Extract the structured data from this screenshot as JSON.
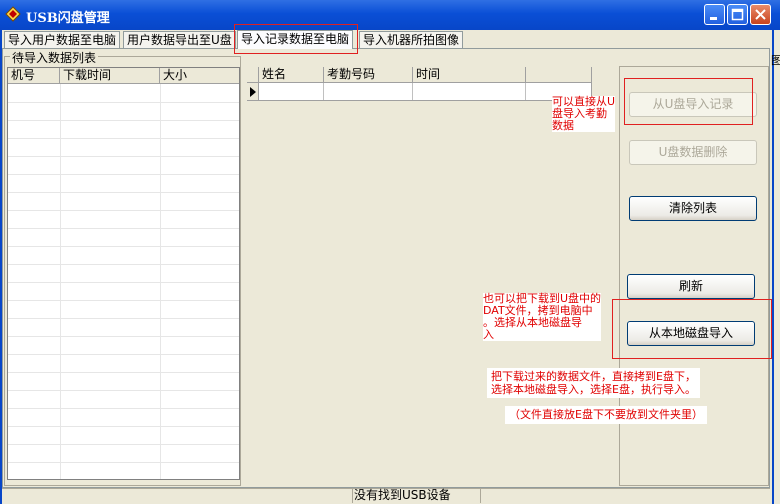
{
  "window": {
    "title": "USB闪盘管理"
  },
  "tabs": [
    {
      "label": "导入用户数据至电脑"
    },
    {
      "label": "用户数据导出至U盘"
    },
    {
      "label": "导入记录数据至电脑"
    },
    {
      "label": "导入机器所拍图像"
    }
  ],
  "active_tab": "导入记录数据至电脑",
  "left_list": {
    "title": "待导入数据列表",
    "columns": [
      "机号",
      "下载时间",
      "大小"
    ]
  },
  "record_grid": {
    "columns": [
      "姓名",
      "考勤号码",
      "时间",
      ""
    ]
  },
  "buttons": {
    "import_from_u": "从U盘导入记录",
    "delete_u": "U盘数据删除",
    "clear_list": "清除列表",
    "refresh": "刷新",
    "import_local": "从本地磁盘导入"
  },
  "notes": {
    "note1": "可以直接从U\n盘导入考勤\n数据",
    "note2": "也可以把下载到U盘中的\nDAT文件，拷到电脑中\n。选择从本地磁盘导\n入",
    "note3": "把下载过来的数据文件，直接拷到E盘下，\n选择本地磁盘导入，选择E盘，执行导入。",
    "note4": "（文件直接放E盘下不要放到文件夹里）"
  },
  "status": {
    "text": "没有找到USB设备"
  },
  "partial_text": "图",
  "colors": {
    "titlebar": "#0a4fd6",
    "annotation": "#e00000",
    "window_bg": "#ece9d8"
  }
}
